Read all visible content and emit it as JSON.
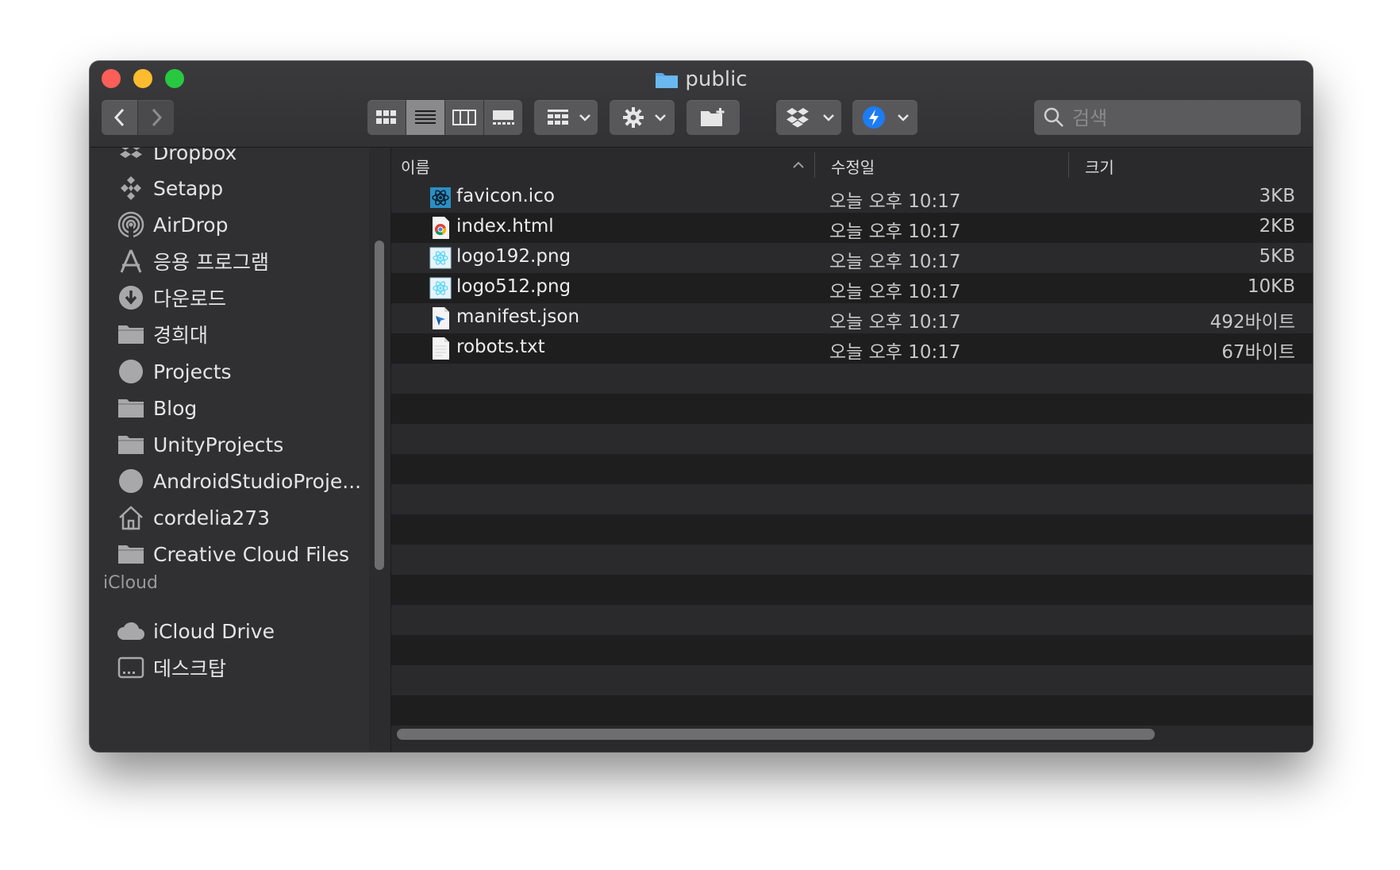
{
  "window": {
    "title": "public"
  },
  "toolbar": {
    "search_placeholder": "검색"
  },
  "sidebar": {
    "items": [
      {
        "label": "Dropbox",
        "icon": "dropbox-icon"
      },
      {
        "label": "Setapp",
        "icon": "setapp-icon"
      },
      {
        "label": "AirDrop",
        "icon": "airdrop-icon"
      },
      {
        "label": "응용 프로그램",
        "icon": "applications-icon"
      },
      {
        "label": "다운로드",
        "icon": "downloads-icon"
      },
      {
        "label": "경희대",
        "icon": "folder-icon"
      },
      {
        "label": "Projects",
        "icon": "circle-icon"
      },
      {
        "label": "Blog",
        "icon": "folder-icon"
      },
      {
        "label": "UnityProjects",
        "icon": "folder-icon"
      },
      {
        "label": "AndroidStudioProje...",
        "icon": "circle-icon"
      },
      {
        "label": "cordelia273",
        "icon": "home-icon"
      },
      {
        "label": "Creative Cloud Files",
        "icon": "folder-icon"
      }
    ],
    "icloud_header": "iCloud",
    "icloud_items": [
      {
        "label": "iCloud Drive",
        "icon": "cloud-icon"
      },
      {
        "label": "데스크탑",
        "icon": "desktop-icon"
      }
    ]
  },
  "columns": {
    "name": "이름",
    "date": "수정일",
    "size": "크기"
  },
  "files": [
    {
      "name": "favicon.ico",
      "date": "오늘 오후 10:17",
      "size": "3KB",
      "icon": "react-icon"
    },
    {
      "name": "index.html",
      "date": "오늘 오후 10:17",
      "size": "2KB",
      "icon": "chrome-icon"
    },
    {
      "name": "logo192.png",
      "date": "오늘 오후 10:17",
      "size": "5KB",
      "icon": "react-image-icon"
    },
    {
      "name": "logo512.png",
      "date": "오늘 오후 10:17",
      "size": "10KB",
      "icon": "react-image-icon"
    },
    {
      "name": "manifest.json",
      "date": "오늘 오후 10:17",
      "size": "492바이트",
      "icon": "json-file-icon"
    },
    {
      "name": "robots.txt",
      "date": "오늘 오후 10:17",
      "size": "67바이트",
      "icon": "text-file-icon"
    }
  ],
  "colors": {
    "accent": "#1d7cf2",
    "folder": "#5aa9e6"
  }
}
